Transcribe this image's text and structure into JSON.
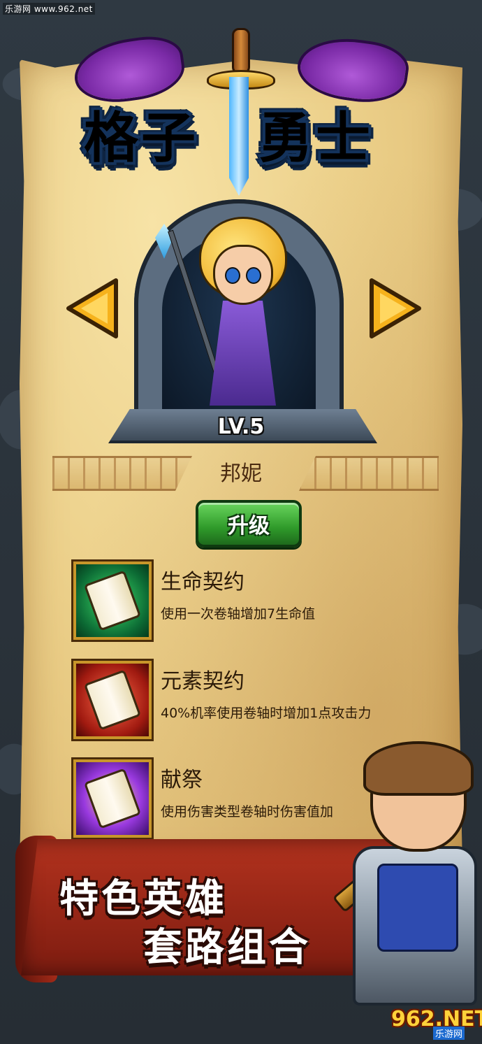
{
  "watermark": "乐游网 www.962.net",
  "logo": {
    "left": "格子",
    "right": "勇士"
  },
  "hero": {
    "level": "LV.5",
    "name": "邦妮"
  },
  "upgrade": {
    "label": "升级"
  },
  "skills": [
    {
      "title": "生命契约",
      "desc": "使用一次卷轴增加7生命值",
      "icon": "scroll-heal-icon"
    },
    {
      "title": "元素契约",
      "desc": "40%机率使用卷轴时增加1点攻击力",
      "icon": "scroll-fire-icon"
    },
    {
      "title": "献祭",
      "desc": "使用伤害类型卷轴时伤害值加",
      "icon": "scroll-magic-icon"
    }
  ],
  "slogan": {
    "line1": "特色英雄",
    "line2": "套路组合"
  },
  "brand": {
    "logo": "962.NET",
    "sub": "乐游网"
  },
  "colors": {
    "accent": "#2f9a2a",
    "ribbon": "#b3321e",
    "parchment": "#ecd08a"
  }
}
